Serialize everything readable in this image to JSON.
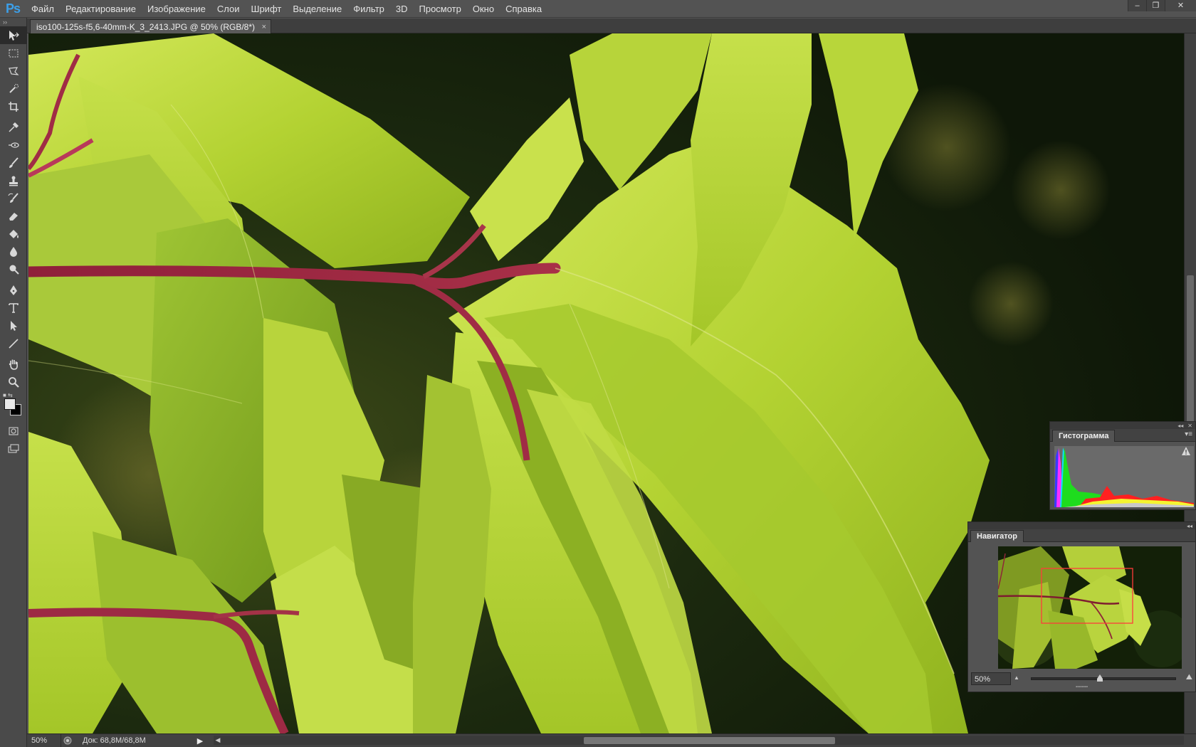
{
  "app": {
    "logo": "Ps"
  },
  "menu": {
    "items": [
      "Файл",
      "Редактирование",
      "Изображение",
      "Слои",
      "Шрифт",
      "Выделение",
      "Фильтр",
      "3D",
      "Просмотр",
      "Окно",
      "Справка"
    ]
  },
  "window_controls": {
    "minimize": "‒",
    "restore": "❐",
    "close": "✕"
  },
  "toolbar": {
    "grip": "››",
    "tools": [
      "move-tool",
      "rect-marquee-tool",
      "lasso-tool",
      "quick-selection-tool",
      "crop-tool",
      "eyedropper-tool",
      "spot-healing-tool",
      "brush-tool",
      "clone-stamp-tool",
      "history-brush-tool",
      "eraser-tool",
      "paint-bucket-tool",
      "blur-tool",
      "dodge-tool",
      "pen-tool",
      "type-tool",
      "path-selection-tool",
      "line-tool",
      "hand-tool",
      "zoom-tool"
    ],
    "foreground_color": "#e8e8e8",
    "background_color": "#000000"
  },
  "document": {
    "tab_title": "iso100-125s-f5,6-40mm-K_3_2413.JPG @ 50% (RGB/8*)",
    "tab_close": "×"
  },
  "status": {
    "zoom": "50%",
    "doc_size": "Док: 68,8M/68,8M",
    "arrow": "▶"
  },
  "histogram_panel": {
    "tab_label": "Гистограмма",
    "menu_icon": "▾≡"
  },
  "navigator_panel": {
    "tab_label": "Навигатор",
    "zoom_value": "50%",
    "zoom_level": 0.5
  },
  "colors": {
    "accent": "#3c9fe8",
    "panel": "#535353",
    "view_box": "#ff3b3b"
  }
}
